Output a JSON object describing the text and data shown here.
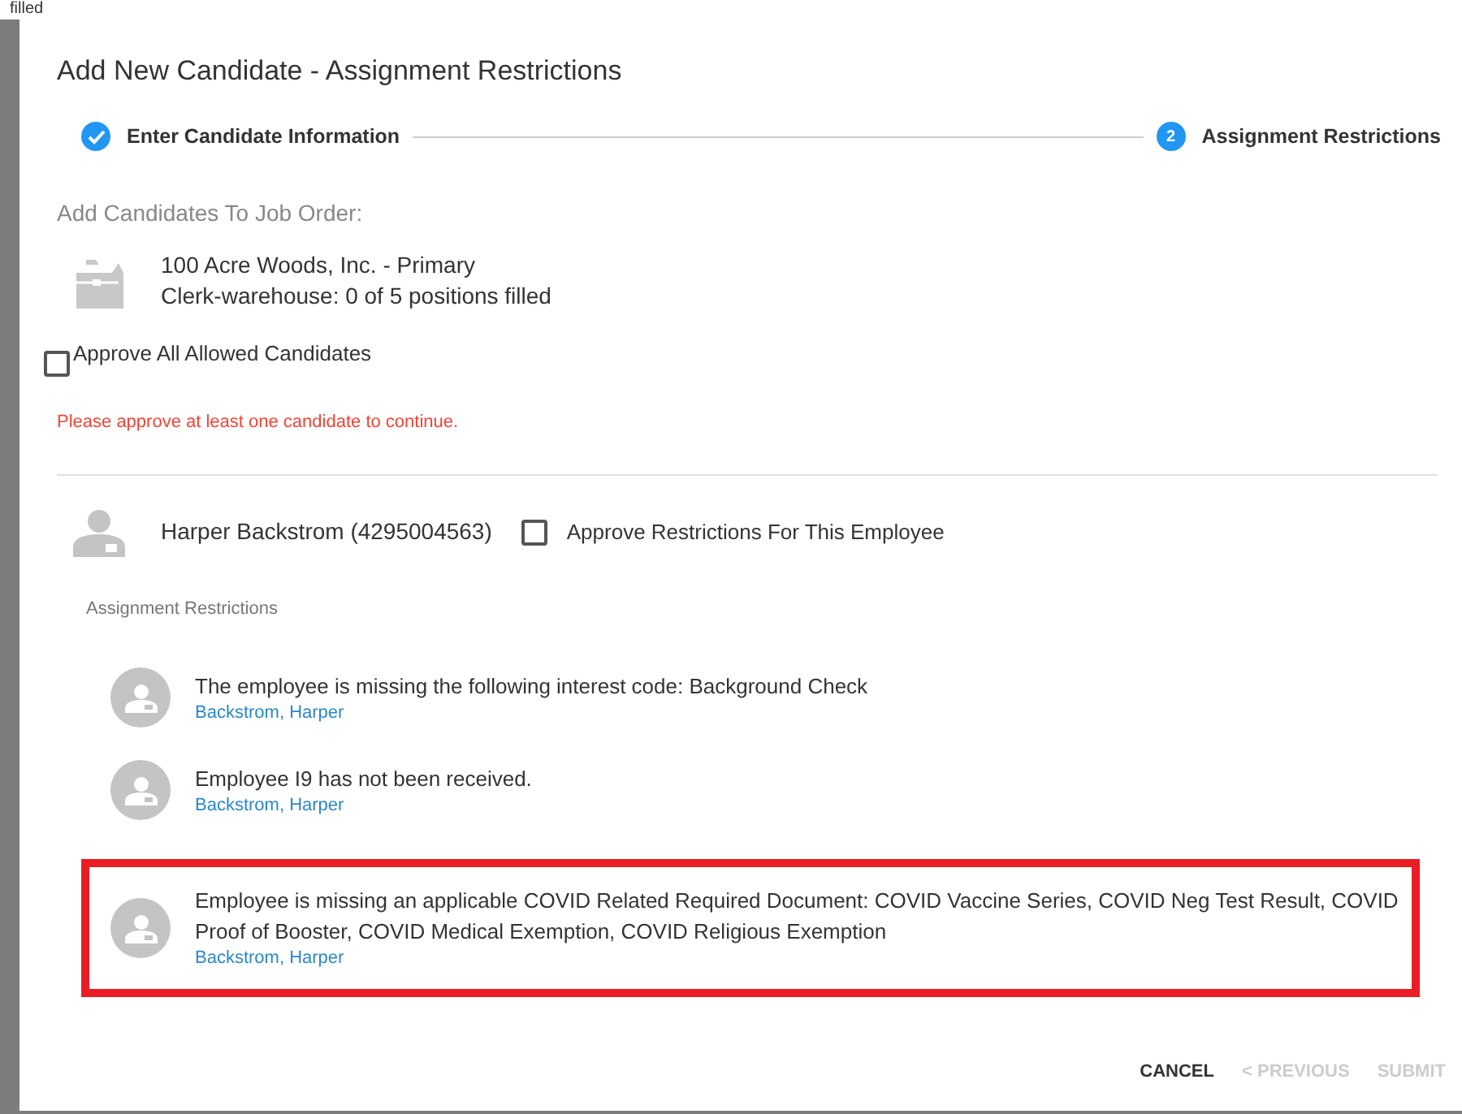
{
  "backdrop": {
    "text": "filled"
  },
  "dialog": {
    "title": "Add New Candidate - Assignment Restrictions"
  },
  "steps": [
    {
      "label": "Enter Candidate Information",
      "completed": true
    },
    {
      "label": "Assignment Restrictions",
      "marker": "2",
      "completed": false
    }
  ],
  "job_order": {
    "heading": "Add Candidates To Job Order:",
    "company": "100 Acre Woods, Inc. - Primary",
    "position": "Clerk-warehouse: 0 of 5 positions filled"
  },
  "approve_all": {
    "label": "Approve All Allowed Candidates",
    "checked": false
  },
  "error": "Please approve at least one candidate to continue.",
  "employee": {
    "name": "Harper Backstrom (4295004563)",
    "approve_label": "Approve Restrictions For This Employee",
    "approved": false
  },
  "restrictions_heading": "Assignment Restrictions",
  "restrictions": [
    {
      "message": "The employee is missing the following interest code: Background Check",
      "person": "Backstrom, Harper",
      "highlighted": false
    },
    {
      "message": "Employee I9 has not been received.",
      "person": "Backstrom, Harper",
      "highlighted": false
    },
    {
      "message": "Employee is missing an applicable COVID Related Required Document: COVID Vaccine Series, COVID Neg Test Result, COVID Proof of Booster, COVID Medical Exemption, COVID Religious Exemption",
      "person": "Backstrom, Harper",
      "highlighted": true
    }
  ],
  "buttons": [
    {
      "label": "CANCEL",
      "disabled": false
    },
    {
      "label": "< PREVIOUS",
      "disabled": true
    },
    {
      "label": "SUBMIT",
      "disabled": true
    }
  ]
}
